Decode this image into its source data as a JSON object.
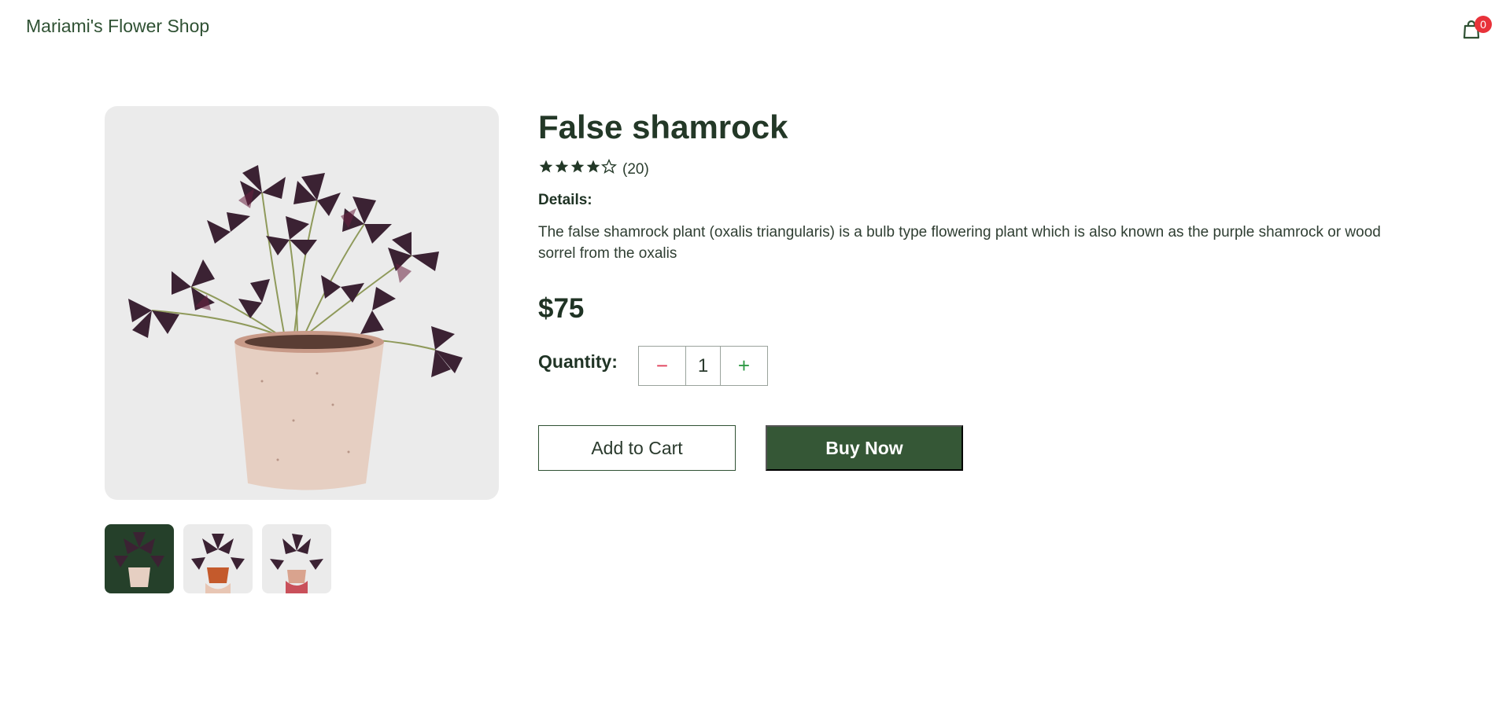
{
  "header": {
    "brand": "Mariami's Flower Shop",
    "cart_icon": "shopping-bag-icon",
    "cart_count": "0"
  },
  "gallery": {
    "main_image": "potted-purple-shamrock-plant",
    "thumbnails": [
      {
        "image": "potted-shamrock-thumbnail",
        "active": true
      },
      {
        "image": "shamrock-in-orange-pot-thumbnail",
        "active": false
      },
      {
        "image": "hand-holding-shamrock-thumbnail",
        "active": false
      }
    ]
  },
  "product": {
    "title": "False shamrock",
    "rating": 4,
    "rating_max": 5,
    "reviews": "(20)",
    "details_label": "Details:",
    "description": "The false shamrock plant (oxalis triangularis) is a bulb type flowering plant which is also known as the purple shamrock or wood sorrel from the oxalis",
    "price": "$75",
    "quantity_label": "Quantity:",
    "quantity_value": "1",
    "decrement_symbol": "−",
    "increment_symbol": "+"
  },
  "actions": {
    "add_to_cart": "Add to Cart",
    "buy_now": "Buy Now"
  },
  "colors": {
    "primary": "#355736",
    "text_dark": "#1f3324",
    "badge": "#e8323a",
    "minus": "#e0405a",
    "plus": "#2e9a45",
    "image_bg": "#ebebeb"
  }
}
